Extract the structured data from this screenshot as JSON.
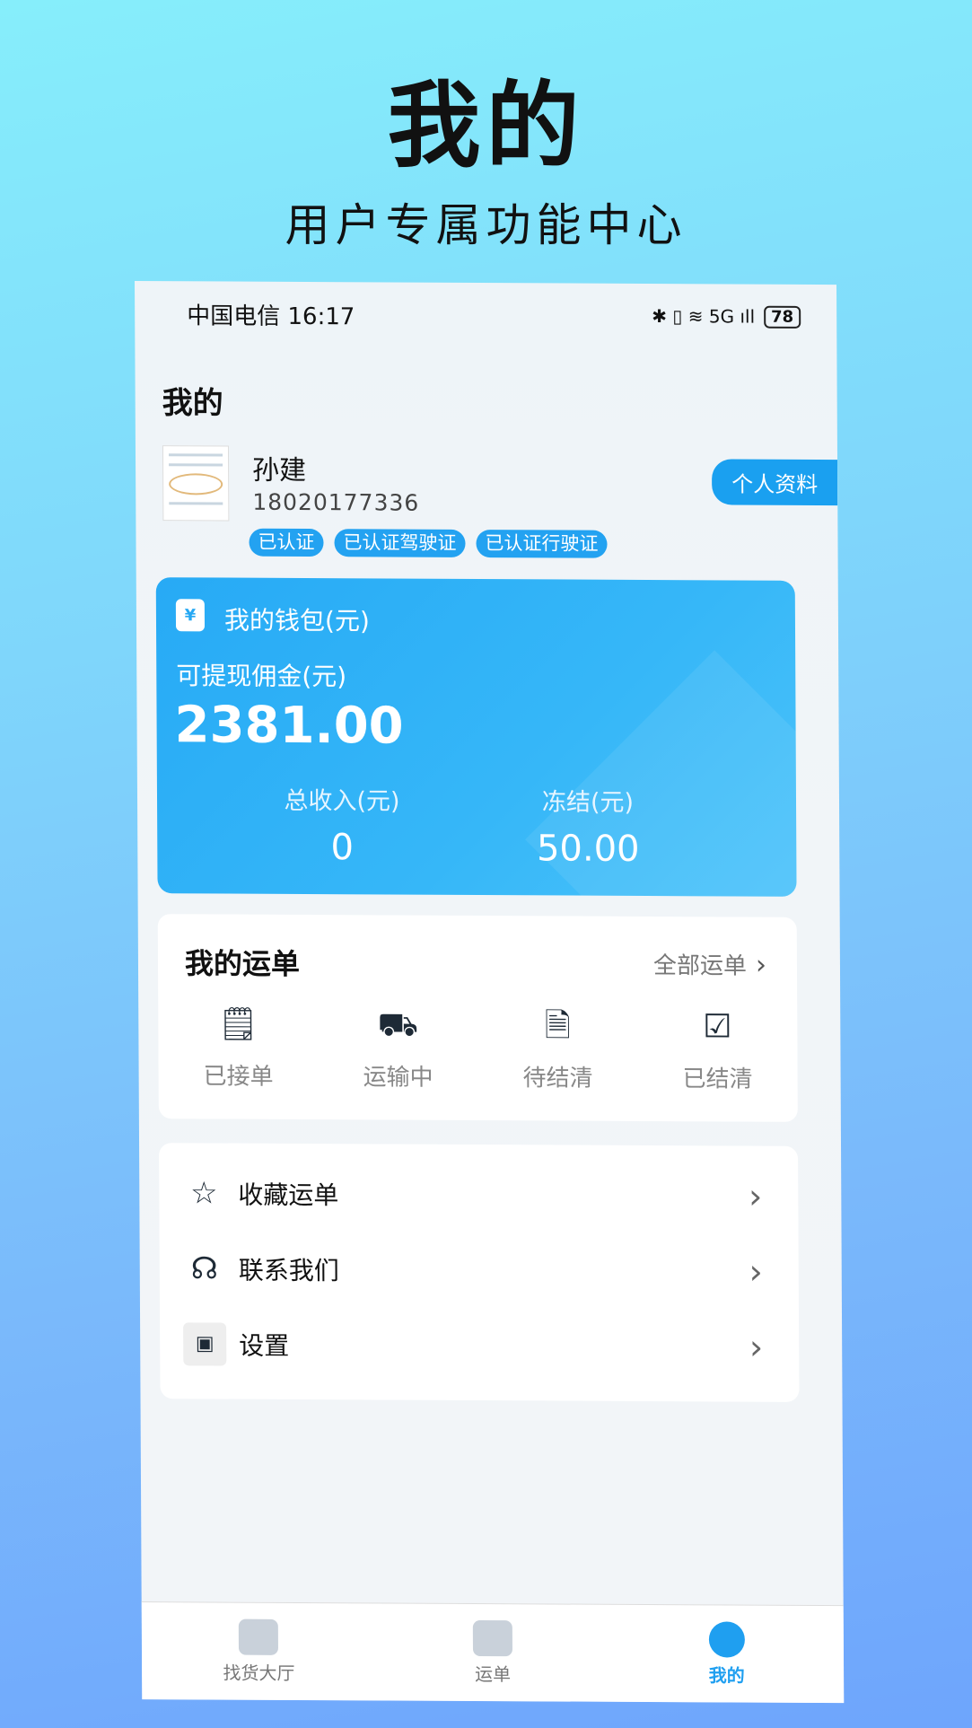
{
  "hero": {
    "title": "我的",
    "subtitle": "用户专属功能中心"
  },
  "status": {
    "carrier_time": "中国电信 16:17",
    "icons": "✱ ▯ ≋ 5G ıll",
    "battery": "78"
  },
  "page_title": "我的",
  "user": {
    "name": "孙建",
    "phone": "18020177336",
    "badges": [
      "已认证",
      "已认证驾驶证",
      "已认证行驶证"
    ],
    "profile_button": "个人资料"
  },
  "wallet": {
    "title": "我的钱包(元)",
    "icon": "¥",
    "withdrawable_label": "可提现佣金(元)",
    "withdrawable_amount": "2381.00",
    "total_income_label": "总收入(元)",
    "total_income_value": "0",
    "frozen_label": "冻结(元)",
    "frozen_value": "50.00"
  },
  "orders": {
    "title": "我的运单",
    "all_label": "全部运单",
    "items": [
      {
        "label": "已接单",
        "icon": "clipboard-check-icon"
      },
      {
        "label": "运输中",
        "icon": "truck-icon"
      },
      {
        "label": "待结清",
        "icon": "clock-doc-icon"
      },
      {
        "label": "已结清",
        "icon": "checkbox-icon"
      }
    ]
  },
  "menu": [
    {
      "label": "收藏运单",
      "icon": "star-icon"
    },
    {
      "label": "联系我们",
      "icon": "headset-icon"
    },
    {
      "label": "设置",
      "icon": "image-icon"
    }
  ],
  "tabs": [
    {
      "label": "找货大厅",
      "icon": "home-icon",
      "active": false
    },
    {
      "label": "运单",
      "icon": "document-icon",
      "active": false
    },
    {
      "label": "我的",
      "icon": "user-icon",
      "active": true
    }
  ]
}
